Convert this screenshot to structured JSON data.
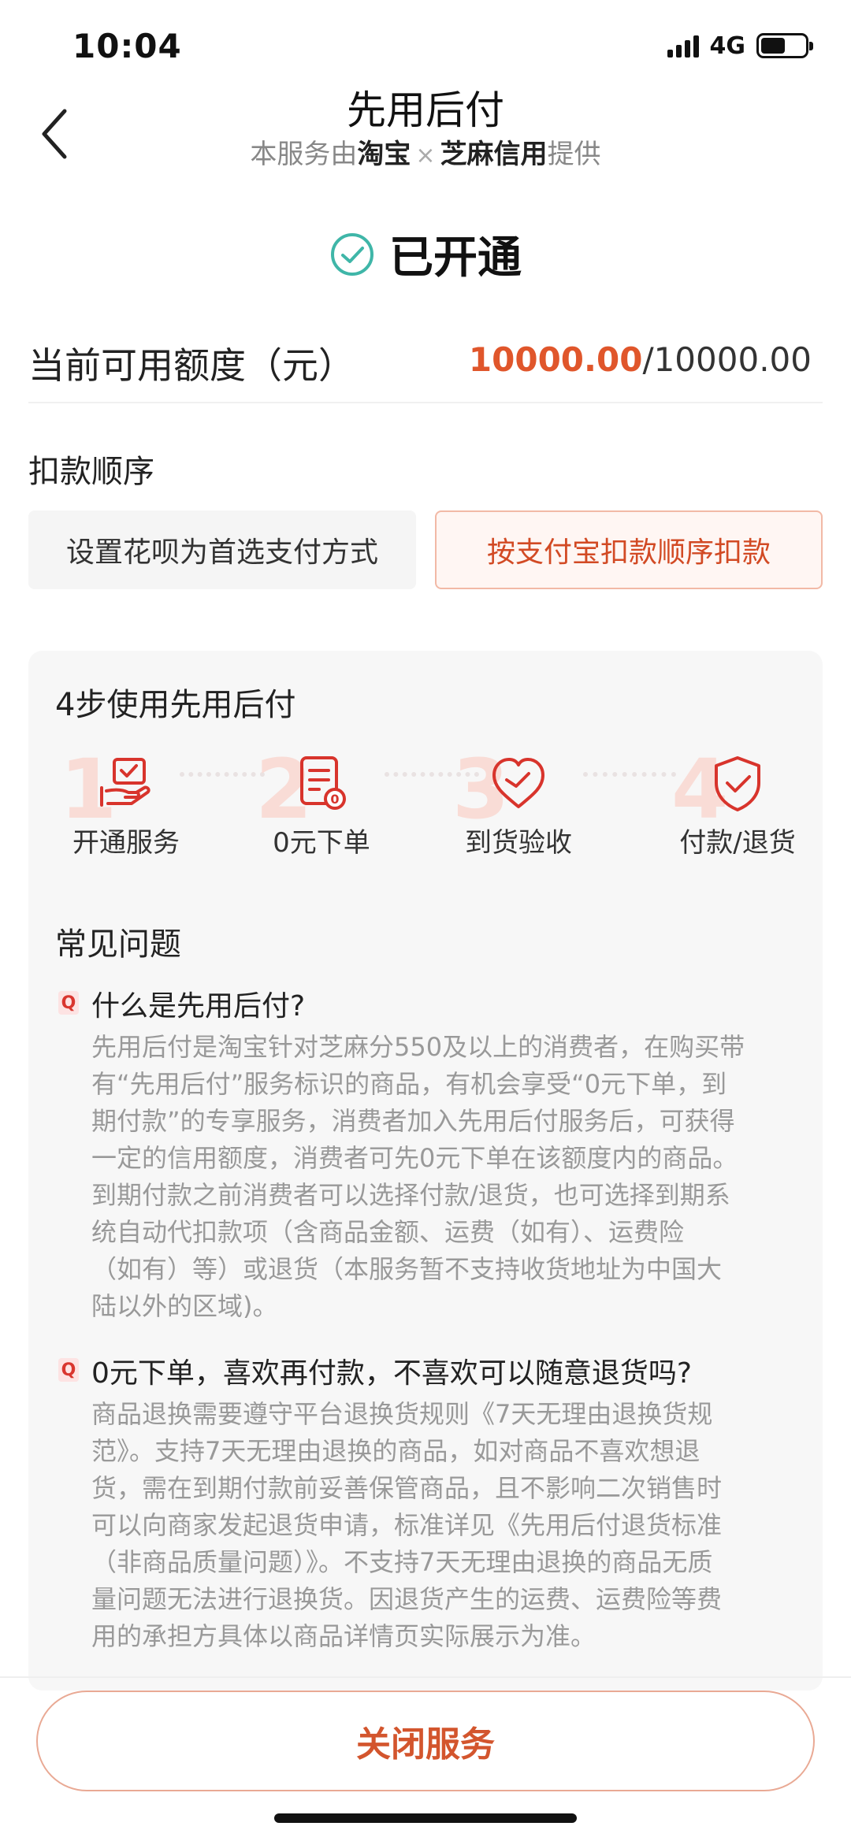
{
  "status_bar": {
    "time": "10:04",
    "network": "4G"
  },
  "header": {
    "title": "先用后付",
    "subtitle_prefix": "本服务由",
    "partner1": "淘宝",
    "times": "×",
    "partner2": "芝麻信用",
    "subtitle_suffix": "提供"
  },
  "status": {
    "text": "已开通"
  },
  "credit": {
    "label": "当前可用额度（元）",
    "current": "10000.00",
    "total": "/10000.00"
  },
  "deduct": {
    "title": "扣款顺序",
    "option1": "设置花呗为首选支付方式",
    "option2": "按支付宝扣款顺序扣款"
  },
  "steps": {
    "title": "4步使用先用后付",
    "items": [
      {
        "num": "1",
        "label": "开通服务",
        "icon": "hand-card-icon"
      },
      {
        "num": "2",
        "label": "0元下单",
        "icon": "order-receipt-icon"
      },
      {
        "num": "3",
        "label": "到货验收",
        "icon": "heart-check-icon"
      },
      {
        "num": "4",
        "label": "付款/退货",
        "icon": "shield-check-icon"
      }
    ]
  },
  "faq": {
    "title": "常见问题",
    "badge": "Q",
    "items": [
      {
        "q": "什么是先用后付?",
        "lines": [
          "先用后付是淘宝针对芝麻分550及以上的消费者，在购买带",
          "有“先用后付”服务标识的商品，有机会享受“0元下单，到",
          "期付款”的专享服务，消费者加入先用后付服务后，可获得",
          "一定的信用额度，消费者可先0元下单在该额度内的商品。",
          "到期付款之前消费者可以选择付款/退货，也可选择到期系",
          "统自动代扣款项（含商品金额、运费（如有）、运费险",
          "（如有）等）或退货（本服务暂不支持收货地址为中国大",
          "陆以外的区域)。"
        ]
      },
      {
        "q": "0元下单，喜欢再付款，不喜欢可以随意退货吗?",
        "lines": [
          "商品退换需要遵守平台退换货规则《7天无理由退换货规",
          "范》。支持7天无理由退换的商品，如对商品不喜欢想退",
          "货，需在到期付款前妥善保管商品，且不影响二次销售时",
          "可以向商家发起退货申请，标准详见《先用后付退货标准",
          "（非商品质量问题）》。不支持7天无理由退换的商品无质",
          "量问题无法进行退换货。因退货产生的运费、运费险等费",
          "用的承担方具体以商品详情页实际展示为准。"
        ]
      }
    ]
  },
  "footer": {
    "close_label": "关闭服务"
  },
  "colors": {
    "accent": "#e0562b",
    "check": "#3fb6a8",
    "step_icon": "#d8342c"
  }
}
